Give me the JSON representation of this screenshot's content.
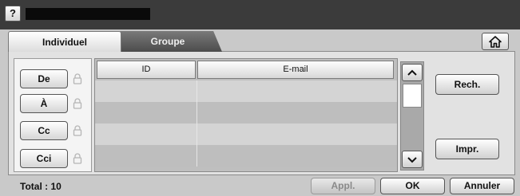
{
  "header": {
    "help_label": "?",
    "title": ""
  },
  "tabs": [
    {
      "label": "Individuel",
      "active": true
    },
    {
      "label": "Groupe",
      "active": false
    }
  ],
  "home": {
    "icon": "home-icon"
  },
  "recipients": [
    {
      "label": "De",
      "icon": "lock-icon"
    },
    {
      "label": "À",
      "icon": "lock-icon"
    },
    {
      "label": "Cc",
      "icon": "lock-icon"
    },
    {
      "label": "Cci",
      "icon": "lock-icon"
    }
  ],
  "table": {
    "columns": [
      "ID",
      "E-mail"
    ],
    "rows": []
  },
  "scrollbar": {
    "up_icon": "chevron-up-icon",
    "down_icon": "chevron-down-icon"
  },
  "actions": {
    "search_label": "Rech.",
    "print_label": "Impr."
  },
  "footer": {
    "total": "Total : 10",
    "apply_label": "Appl.",
    "apply_enabled": false,
    "ok_label": "OK",
    "cancel_label": "Annuler"
  }
}
